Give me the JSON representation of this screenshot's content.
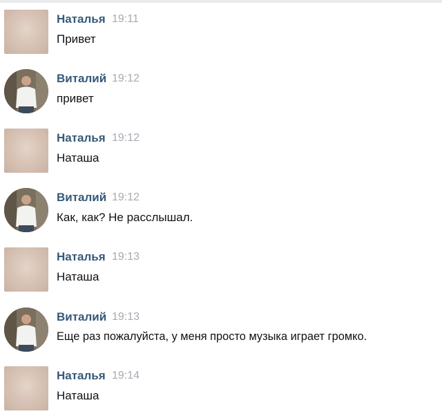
{
  "messages": [
    {
      "author": "Наталья",
      "time": "19:11",
      "text": "Привет",
      "avatar": "natalia-avatar"
    },
    {
      "author": "Виталий",
      "time": "19:12",
      "text": "привет",
      "avatar": "vitaly-avatar"
    },
    {
      "author": "Наталья",
      "time": "19:12",
      "text": "Наташа",
      "avatar": "natalia-avatar"
    },
    {
      "author": "Виталий",
      "time": "19:12",
      "text": "Как, как? Не расслышал.",
      "avatar": "vitaly-avatar"
    },
    {
      "author": "Наталья",
      "time": "19:13",
      "text": "Наташа",
      "avatar": "natalia-avatar"
    },
    {
      "author": "Виталий",
      "time": "19:13",
      "text": "Еще раз пожалуйста, у меня просто музыка играет громко.",
      "avatar": "vitaly-avatar"
    },
    {
      "author": "Наталья",
      "time": "19:14",
      "text": "Наташа",
      "avatar": "natalia-avatar"
    }
  ],
  "colors": {
    "author": "#36597a",
    "time": "#a5abb2",
    "text": "#111111"
  }
}
